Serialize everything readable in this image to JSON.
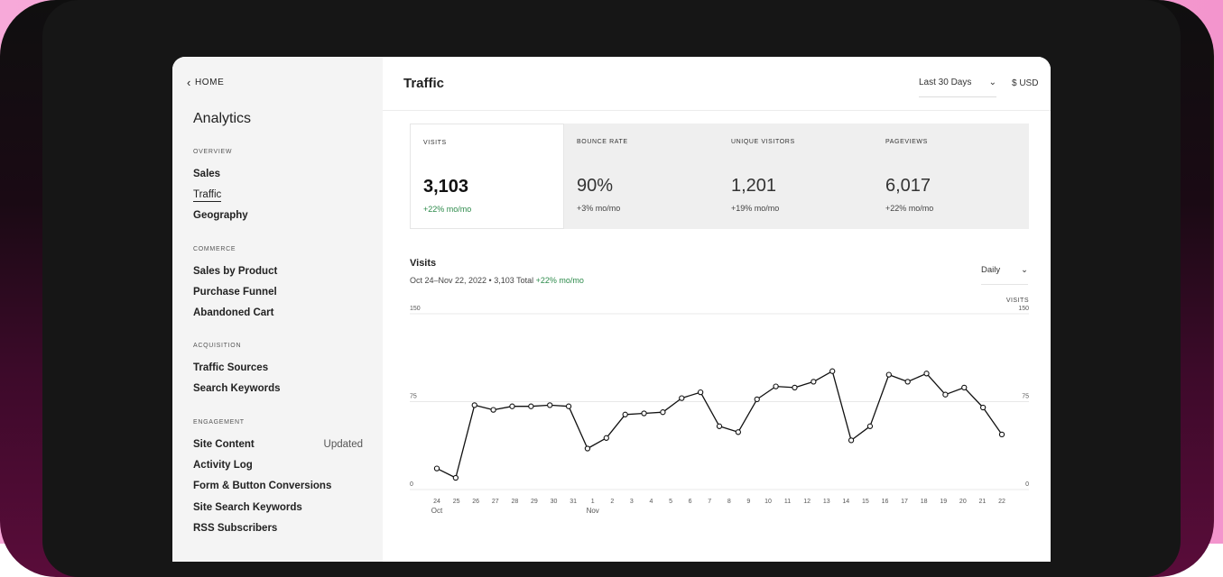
{
  "sidebar": {
    "home_label": "HOME",
    "title": "Analytics",
    "sections": [
      {
        "heading": "OVERVIEW",
        "items": [
          {
            "label": "Sales",
            "badge": ""
          },
          {
            "label": "Traffic",
            "badge": "",
            "active": true
          },
          {
            "label": "Geography",
            "badge": ""
          }
        ]
      },
      {
        "heading": "COMMERCE",
        "items": [
          {
            "label": "Sales by Product",
            "badge": ""
          },
          {
            "label": "Purchase Funnel",
            "badge": ""
          },
          {
            "label": "Abandoned Cart",
            "badge": ""
          }
        ]
      },
      {
        "heading": "ACQUISITION",
        "items": [
          {
            "label": "Traffic Sources",
            "badge": ""
          },
          {
            "label": "Search Keywords",
            "badge": ""
          }
        ]
      },
      {
        "heading": "ENGAGEMENT",
        "items": [
          {
            "label": "Site Content",
            "badge": "Updated"
          },
          {
            "label": "Activity Log",
            "badge": ""
          },
          {
            "label": "Form & Button Conversions",
            "badge": ""
          },
          {
            "label": "Site Search Keywords",
            "badge": ""
          },
          {
            "label": "RSS Subscribers",
            "badge": ""
          }
        ]
      }
    ]
  },
  "header": {
    "title": "Traffic",
    "range": "Last 30 Days",
    "currency": "$ USD"
  },
  "stats": [
    {
      "label": "VISITS",
      "value": "3,103",
      "change": "+22% mo/mo"
    },
    {
      "label": "BOUNCE RATE",
      "value": "90%",
      "change": "+3% mo/mo"
    },
    {
      "label": "UNIQUE VISITORS",
      "value": "1,201",
      "change": "+19% mo/mo"
    },
    {
      "label": "PAGEVIEWS",
      "value": "6,017",
      "change": "+22% mo/mo"
    }
  ],
  "chart": {
    "title": "Visits",
    "subtitle": "Oct 24–Nov 22, 2022 • 3,103 Total",
    "subtitle_change": "+22% mo/mo",
    "granularity": "Daily"
  },
  "colors": {
    "positive": "#2c8a4a",
    "line": "#111111"
  },
  "chart_data": {
    "type": "line",
    "x": [
      "24",
      "25",
      "26",
      "27",
      "28",
      "29",
      "30",
      "31",
      "1",
      "2",
      "3",
      "4",
      "5",
      "6",
      "7",
      "8",
      "9",
      "10",
      "11",
      "12",
      "13",
      "14",
      "15",
      "16",
      "17",
      "18",
      "19",
      "20",
      "21",
      "22"
    ],
    "month_labels": {
      "0": "Oct",
      "8": "Nov"
    },
    "series": [
      {
        "values": [
          18,
          10,
          72,
          68,
          71,
          71,
          72,
          71,
          35,
          44,
          64,
          65,
          66,
          78,
          83,
          54,
          49,
          77,
          88,
          87,
          92,
          101,
          42,
          54,
          98,
          92,
          99,
          81,
          87,
          70,
          47
        ]
      }
    ],
    "ylim": [
      0,
      150
    ],
    "yticks": [
      0,
      75,
      150
    ],
    "y_right_label": "VISITS",
    "grid": true
  }
}
